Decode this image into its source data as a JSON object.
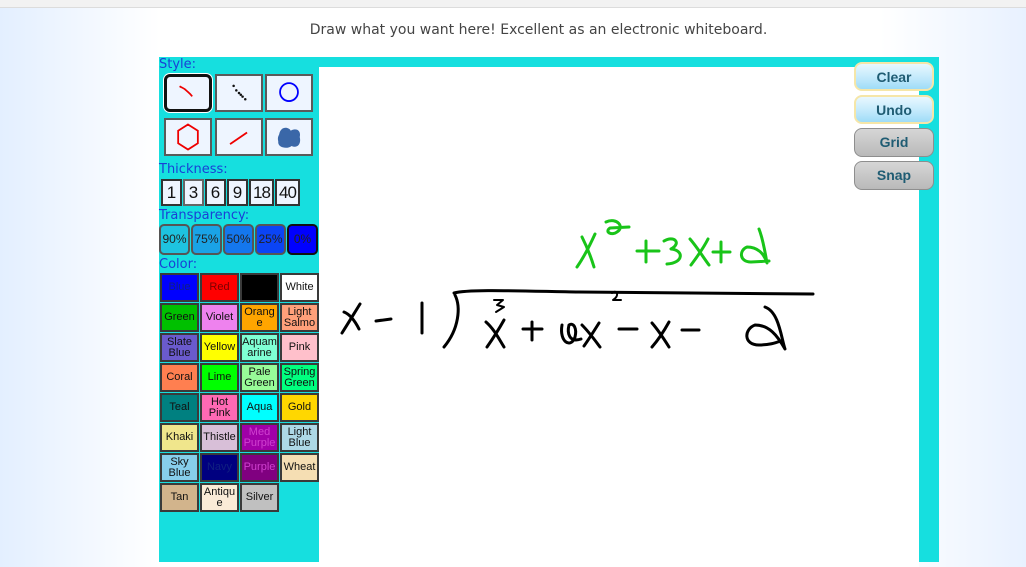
{
  "instructions": "Draw what you want here! Excellent as an electronic whiteboard.",
  "toolbar": {
    "style_label": "Style:",
    "styles": [
      {
        "name": "freehand",
        "icon": "freehand-line-icon",
        "selected": true
      },
      {
        "name": "dotted",
        "icon": "dotted-line-icon",
        "selected": false
      },
      {
        "name": "circle",
        "icon": "circle-icon",
        "selected": false
      },
      {
        "name": "polygon",
        "icon": "hexagon-icon",
        "selected": false
      },
      {
        "name": "line",
        "icon": "straight-line-icon",
        "selected": false
      },
      {
        "name": "fill",
        "icon": "blob-fill-icon",
        "selected": false
      }
    ],
    "thickness_label": "Thickness:",
    "thickness": [
      "1",
      "3",
      "6",
      "9",
      "18",
      "40"
    ],
    "thickness_selected": "3",
    "transparency_label": "Transparency:",
    "transparency": [
      {
        "label": "90%",
        "color": "#1ec3e0"
      },
      {
        "label": "75%",
        "color": "#1aa3e6"
      },
      {
        "label": "50%",
        "color": "#1477ee"
      },
      {
        "label": "25%",
        "color": "#0b44f5"
      },
      {
        "label": "0%",
        "color": "#0000ff"
      }
    ],
    "color_label": "Color:",
    "colors": [
      {
        "label": "Blue",
        "hex": "#0000ff"
      },
      {
        "label": "Red",
        "hex": "#ff0000"
      },
      {
        "label": "",
        "hex": "#000000"
      },
      {
        "label": "White",
        "hex": "#ffffff"
      },
      {
        "label": "Green",
        "hex": "#00c000"
      },
      {
        "label": "Violet",
        "hex": "#ee82ee"
      },
      {
        "label": "Orang e",
        "hex": "#ffa500"
      },
      {
        "label": "Light Salmo",
        "hex": "#ffa07a"
      },
      {
        "label": "Slate Blue",
        "hex": "#6a5acd"
      },
      {
        "label": "Yellow",
        "hex": "#ffff00"
      },
      {
        "label": "Aquam arine",
        "hex": "#7fffd4"
      },
      {
        "label": "Pink",
        "hex": "#ffc0cb"
      },
      {
        "label": "Coral",
        "hex": "#ff7f50"
      },
      {
        "label": "Lime",
        "hex": "#00ff00"
      },
      {
        "label": "Pale Green",
        "hex": "#98fb98"
      },
      {
        "label": "Spring Green",
        "hex": "#00ff7f"
      },
      {
        "label": "Teal",
        "hex": "#008080"
      },
      {
        "label": "Hot Pink",
        "hex": "#ff69b4"
      },
      {
        "label": "Aqua",
        "hex": "#00ffff"
      },
      {
        "label": "Gold",
        "hex": "#ffd700"
      },
      {
        "label": "Khaki",
        "hex": "#f0e68c"
      },
      {
        "label": "Thistle",
        "hex": "#d8bfd8"
      },
      {
        "label": "Med Purple",
        "hex": "#a000a8"
      },
      {
        "label": "Light Blue",
        "hex": "#add8e6"
      },
      {
        "label": "Sky Blue",
        "hex": "#87ceeb"
      },
      {
        "label": "Navy",
        "hex": "#000080"
      },
      {
        "label": "Purple",
        "hex": "#800080"
      },
      {
        "label": "Wheat",
        "hex": "#f5deb3"
      },
      {
        "label": "Tan",
        "hex": "#d2b48c"
      },
      {
        "label": "Antiqu e",
        "hex": "#faebd7"
      },
      {
        "label": "Silver",
        "hex": "#c0c0c0"
      }
    ]
  },
  "actions": {
    "clear": "Clear",
    "undo": "Undo",
    "grid": "Grid",
    "snap": "Snap"
  },
  "canvas": {
    "drawing_description": "Handwritten polynomial long division: (x^3 + 2x^2 - x - 2) ÷ (x - 1), quotient x^2 + 3x + 2 in green",
    "divisor": "x-1",
    "dividend": "x^3+2x^2-x-2",
    "quotient": "x^2+3x+2",
    "ink_colors": {
      "black": "#000000",
      "green": "#19c419"
    }
  }
}
